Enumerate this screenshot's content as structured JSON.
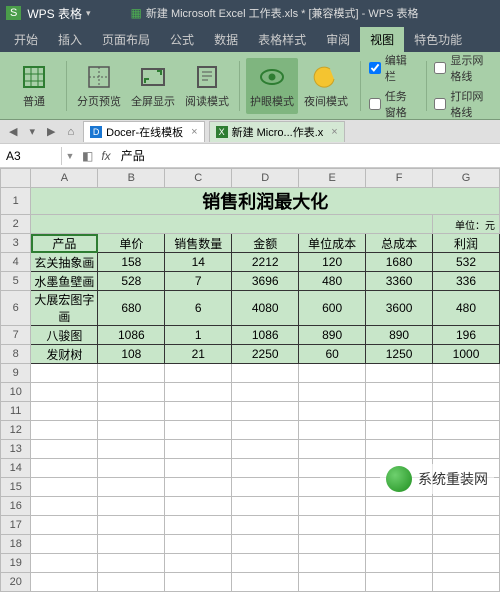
{
  "title": {
    "logo": "S",
    "app": "WPS 表格",
    "doc": "新建 Microsoft Excel 工作表.xls * [兼容模式] - WPS 表格"
  },
  "menu": [
    "开始",
    "插入",
    "页面布局",
    "公式",
    "数据",
    "审阅",
    "视图",
    "特色功能",
    "表格样式"
  ],
  "menu_order": [
    0,
    1,
    2,
    3,
    4,
    8,
    5,
    6,
    7
  ],
  "menu_active": 6,
  "ribbon": {
    "buttons": [
      "普通",
      "分页预览",
      "全屏显示",
      "阅读模式",
      "护眼模式",
      "夜间模式"
    ],
    "active": 4,
    "checks1": [
      {
        "label": "编辑栏",
        "checked": true
      },
      {
        "label": "任务窗格",
        "checked": false
      }
    ],
    "checks2": [
      {
        "label": "显示网格线",
        "checked": false
      },
      {
        "label": "打印网格线",
        "checked": false
      }
    ]
  },
  "tabbar": {
    "tabs": [
      {
        "label": "Docer-在线模板",
        "icon": "D"
      },
      {
        "label": "新建 Micro...作表.x",
        "icon": "X"
      }
    ]
  },
  "namebox": "A3",
  "formula": "产品",
  "cols": [
    "A",
    "B",
    "C",
    "D",
    "E",
    "F",
    "G"
  ],
  "sheet": {
    "title": "销售利润最大化",
    "unit": "单位：元",
    "headers": [
      "产品",
      "单价",
      "销售数量",
      "金额",
      "单位成本",
      "总成本",
      "利润"
    ],
    "rows": [
      [
        "玄关抽象画",
        "158",
        "14",
        "2212",
        "120",
        "1680",
        "532"
      ],
      [
        "水墨鱼壁画",
        "528",
        "7",
        "3696",
        "480",
        "3360",
        "336"
      ],
      [
        "大展宏图字画",
        "680",
        "6",
        "4080",
        "600",
        "3600",
        "480"
      ],
      [
        "八骏图",
        "1086",
        "1",
        "1086",
        "890",
        "890",
        "196"
      ],
      [
        "发财树",
        "108",
        "21",
        "2250",
        "60",
        "1250",
        "1000"
      ]
    ]
  },
  "watermark": "系统重装网"
}
